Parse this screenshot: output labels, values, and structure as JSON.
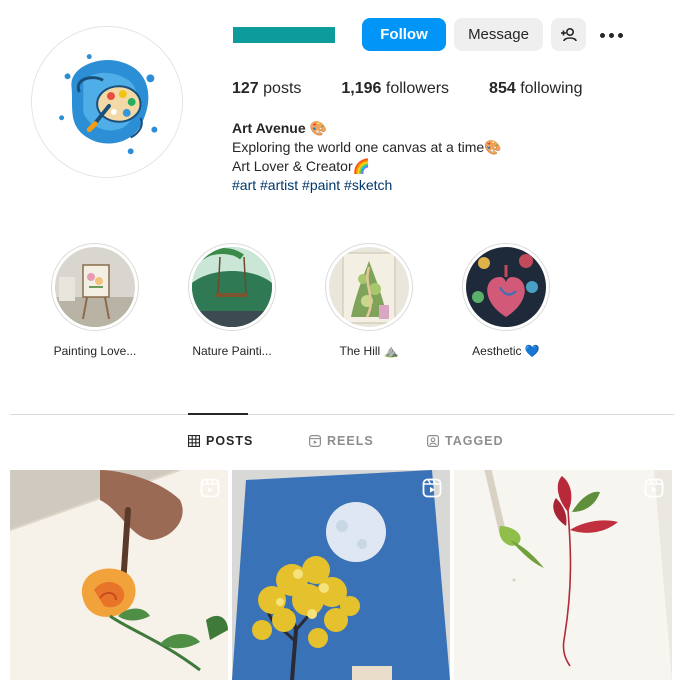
{
  "profile": {
    "follow_label": "Follow",
    "message_label": "Message",
    "add_user_icon": "person-plus-icon",
    "more_icon": "more-options-icon",
    "username_color": "#0d9b9b"
  },
  "stats": {
    "posts_count": "127",
    "posts_label": "posts",
    "followers_count": "1,196",
    "followers_label": "followers",
    "following_count": "854",
    "following_label": "following"
  },
  "bio": {
    "name": "Art Avenue 🎨",
    "line1": "Exploring the world one canvas at a time🎨",
    "line2": "Art Lover & Creator🌈",
    "tags": "#art #artist #paint #sketch"
  },
  "highlights": [
    {
      "label": "Painting Love..."
    },
    {
      "label": "Nature Painti..."
    },
    {
      "label": "The Hill ⛰️"
    },
    {
      "label": "Aesthetic 💙"
    }
  ],
  "tabs": [
    {
      "label": "POSTS",
      "icon": "grid-icon",
      "active": true
    },
    {
      "label": "REELS",
      "icon": "reels-icon",
      "active": false
    },
    {
      "label": "TAGGED",
      "icon": "tagged-icon",
      "active": false
    }
  ],
  "posts": [
    {
      "description_icon": "reel-icon",
      "type": "reel"
    },
    {
      "description_icon": "reel-icon",
      "type": "reel"
    },
    {
      "description_icon": "reel-icon",
      "type": "reel"
    }
  ],
  "colors": {
    "accent": "#0095f6",
    "link": "#00376b",
    "muted": "#8e8e8e"
  }
}
